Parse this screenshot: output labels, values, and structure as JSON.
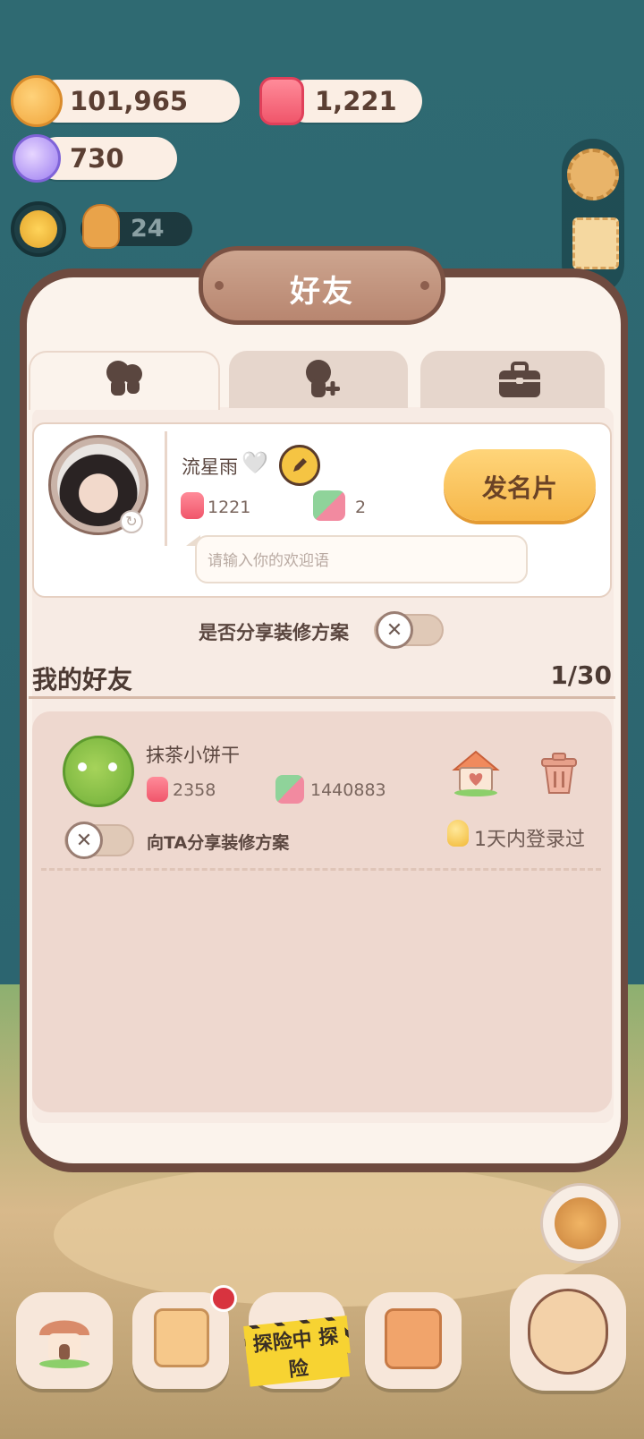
{
  "currencies": {
    "cookies": "101,965",
    "gems": "1,221",
    "candy": "730",
    "cookie_count": "24"
  },
  "modal": {
    "title": "好友"
  },
  "tabs": [
    {
      "name": "friends-tab",
      "icon": "friends-icon"
    },
    {
      "name": "add-friend-tab",
      "icon": "add-friend-icon"
    },
    {
      "name": "briefcase-tab",
      "icon": "briefcase-icon"
    }
  ],
  "profile": {
    "name": "流星雨",
    "heart": "🤍",
    "stat_gems": "1221",
    "stat_likes": "2",
    "send_card": "发名片",
    "greeting_placeholder": "请输入你的欢迎语"
  },
  "share_plan": {
    "label": "是否分享装修方案",
    "enabled": false
  },
  "friends": {
    "header": "我的好友",
    "count": "1/30",
    "items": [
      {
        "name": "抹茶小饼干",
        "stat_gems": "2358",
        "stat_likes": "1440883",
        "share_label": "向TA分享装修方案",
        "login_status": "1天内登录过"
      }
    ]
  },
  "bottom_nav": {
    "adventure_label": "探险中 探险"
  },
  "colors": {
    "accent": "#f6b74a",
    "modal_border": "#6e4a3f",
    "background": "#2f6b73"
  }
}
